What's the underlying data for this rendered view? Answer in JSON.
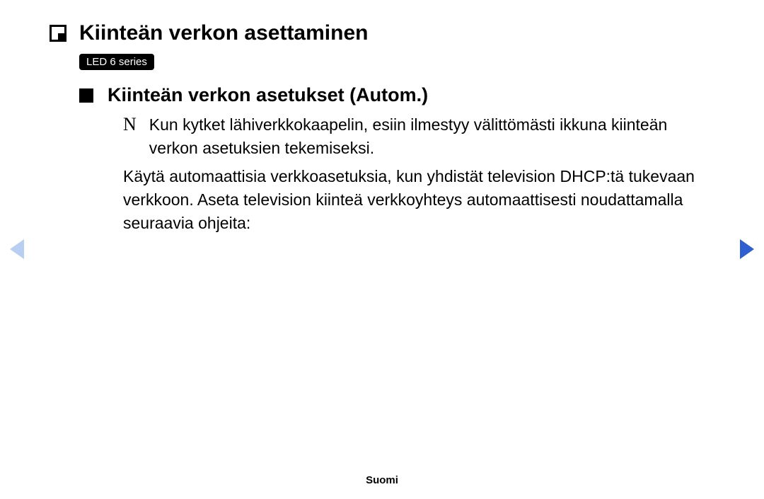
{
  "h1": "Kiinteän verkon asettaminen",
  "badge": "LED 6 series",
  "h2": "Kiinteän verkon asetukset (Autom.)",
  "note_icon": "N",
  "note_text": "Kun kytket lähiverkkokaapelin, esiin ilmestyy välittömästi ikkuna kiinteän verkon asetuksien tekemiseksi.",
  "paragraph": "Käytä automaattisia verkkoasetuksia, kun yhdistät television DHCP:tä tukevaan verkkoon. Aseta television kiinteä verkkoyhteys automaattisesti noudattamalla seuraavia ohjeita:",
  "footer": "Suomi"
}
